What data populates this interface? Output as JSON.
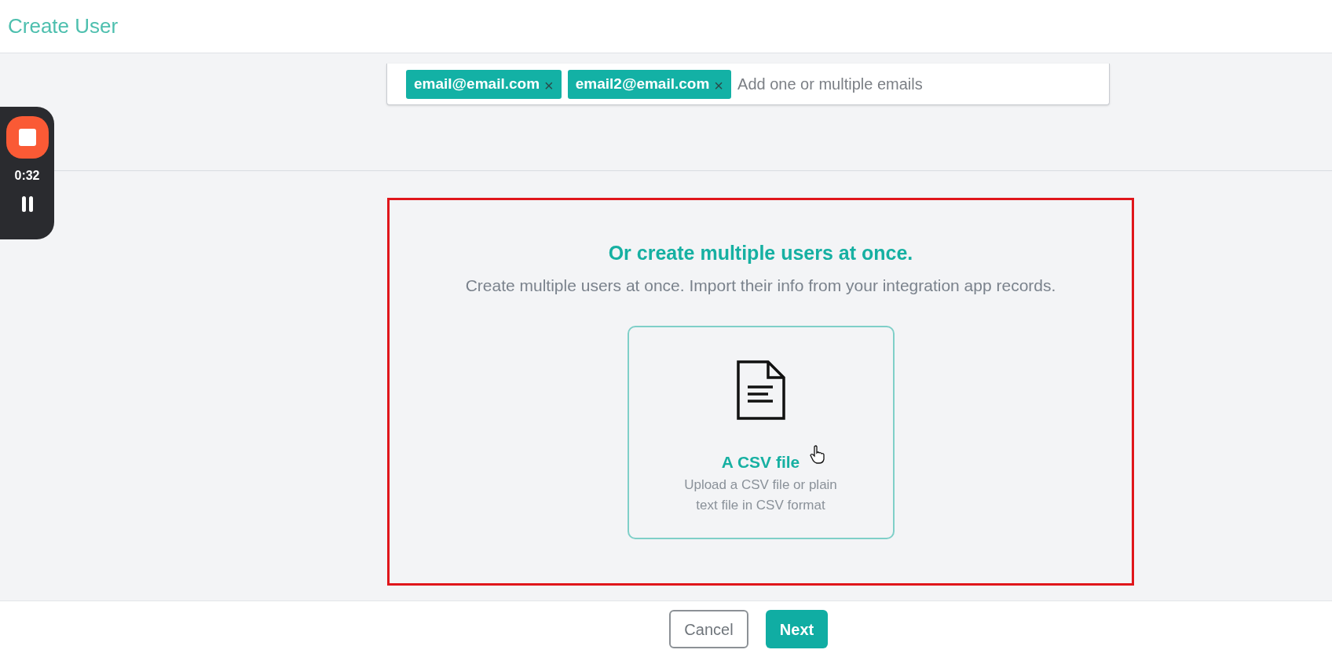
{
  "header": {
    "title": "Create User"
  },
  "email_field": {
    "tags": [
      {
        "label": "email@email.com",
        "remove": "×"
      },
      {
        "label": "email2@email.com",
        "remove": "×"
      }
    ],
    "placeholder": "Add one or multiple emails"
  },
  "recorder": {
    "time": "0:32"
  },
  "bulk_section": {
    "title": "Or create multiple users at once.",
    "subtitle": "Create multiple users at once. Import their info from your integration app records.",
    "options": [
      {
        "title": "A CSV file",
        "description": "Upload a CSV file or plain text file in CSV format"
      }
    ]
  },
  "footer": {
    "buttons": [
      {
        "label": "Cancel",
        "kind": "secondary"
      },
      {
        "label": "Next",
        "kind": "primary"
      }
    ]
  }
}
